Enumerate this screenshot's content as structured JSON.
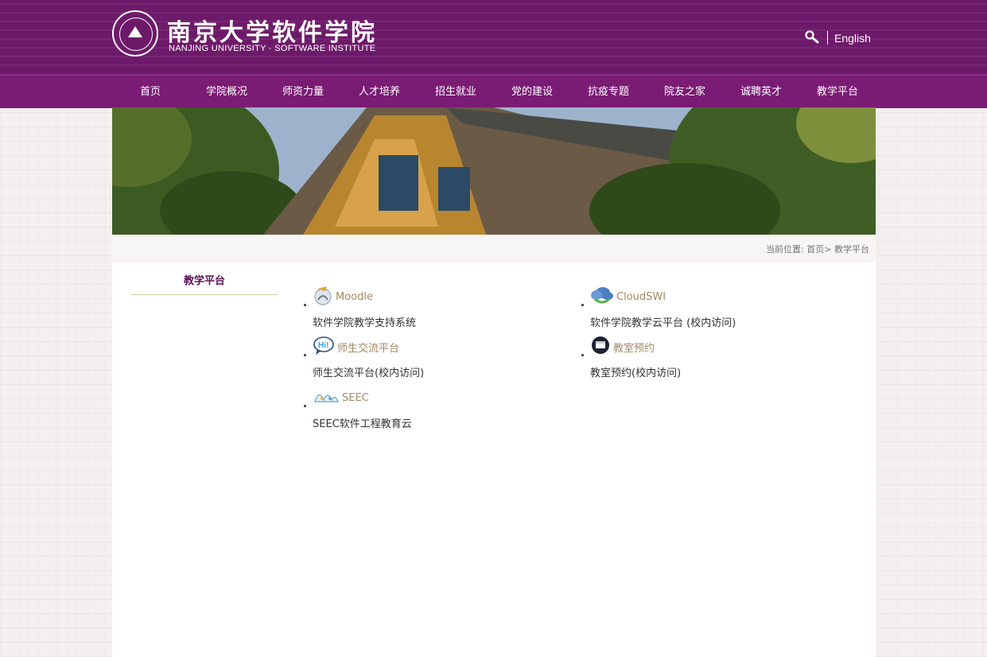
{
  "header": {
    "logo_cn": "南京大学软件学院",
    "logo_en": "NANJING UNIVERSITY · SOFTWARE INSTITUTE",
    "search_icon": "search-icon",
    "lang_link": "English"
  },
  "nav": {
    "items": [
      {
        "label": "首页"
      },
      {
        "label": "学院概况"
      },
      {
        "label": "师资力量"
      },
      {
        "label": "人才培养"
      },
      {
        "label": "招生就业"
      },
      {
        "label": "党的建设"
      },
      {
        "label": "抗疫专题"
      },
      {
        "label": "院友之家"
      },
      {
        "label": "诚聘英才"
      },
      {
        "label": "教学平台"
      }
    ]
  },
  "breadcrumb": {
    "prefix": "当前位置:",
    "home": "首页",
    "sep": ">",
    "current": "教学平台"
  },
  "sidebar": {
    "title": "教学平台"
  },
  "platforms": [
    {
      "name": "Moodle",
      "icon": "moodle-icon",
      "desc": "软件学院教学支持系统"
    },
    {
      "name": "CloudSWI",
      "icon": "cloud-icon",
      "desc": "软件学院教学云平台 (校内访问)"
    },
    {
      "name": "师生交流平台",
      "icon": "hi-chat-icon",
      "desc": "师生交流平台(校内访问)"
    },
    {
      "name": "教室预约",
      "icon": "classroom-icon",
      "desc": "教室预约(校内访问)"
    },
    {
      "name": "SEEC",
      "icon": "seec-icon",
      "desc": "SEEC软件工程教育云"
    }
  ],
  "colors": {
    "brand_purple": "#6e1a6a",
    "nav_purple": "#7a1b74",
    "title_purple": "#5c1358",
    "platform_name": "#a08a62"
  }
}
